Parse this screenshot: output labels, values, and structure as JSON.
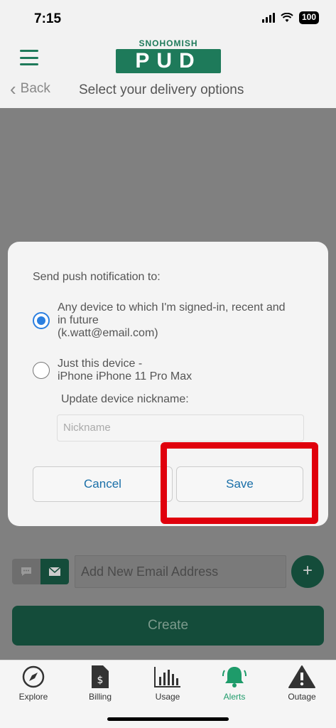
{
  "status": {
    "time": "7:15",
    "battery": "100"
  },
  "header": {
    "logo_top": "SNOHOMISH",
    "logo_main": "PUD",
    "back_label": "Back",
    "title": "Select your delivery options"
  },
  "background": {
    "add_email_placeholder": "Add New Email Address",
    "create_label": "Create"
  },
  "modal": {
    "heading": "Send push notification to:",
    "option_any_line1": "Any device to which I'm signed-in, recent and",
    "option_any_line2": "in future",
    "option_any_email": "(k.watt@email.com)",
    "option_this_line1": "Just this device -",
    "option_this_line2": "iPhone iPhone 11 Pro Max",
    "nickname_label": "Update device nickname:",
    "nickname_placeholder": "Nickname",
    "nickname_value": "",
    "cancel_label": "Cancel",
    "save_label": "Save",
    "selected_option": "any_device"
  },
  "tabs": [
    {
      "label": "Explore",
      "icon": "compass-icon",
      "active": false
    },
    {
      "label": "Billing",
      "icon": "bill-icon",
      "active": false
    },
    {
      "label": "Usage",
      "icon": "bar-chart-icon",
      "active": false
    },
    {
      "label": "Alerts",
      "icon": "bell-icon",
      "active": true
    },
    {
      "label": "Outage",
      "icon": "warning-icon",
      "active": false
    }
  ],
  "colors": {
    "brand_green": "#1e7a5a",
    "active_tab": "#1e9b6a",
    "link_blue": "#1a6fa8",
    "radio_blue": "#2b7fe0",
    "highlight_red": "#e0000c"
  }
}
